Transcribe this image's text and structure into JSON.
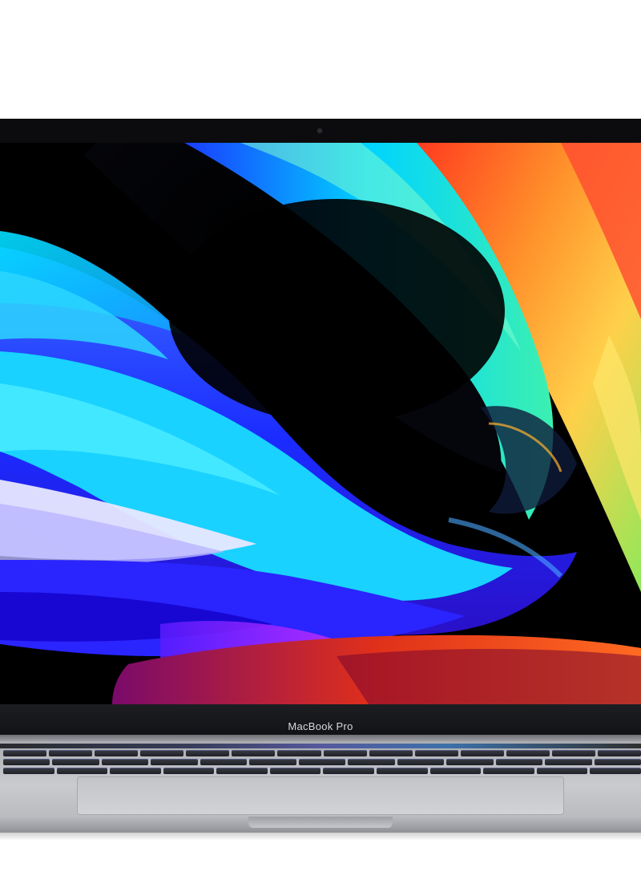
{
  "product": {
    "model_label": "MacBook Pro"
  },
  "colors": {
    "background": "#ffffff",
    "bezel": "#0c0c0e",
    "chassis": "#c9cbcf",
    "wallpaper_accents": [
      "#2f2cff",
      "#00e5ff",
      "#28d7a8",
      "#ffb02e",
      "#ff3b1f",
      "#7a2cff"
    ]
  }
}
